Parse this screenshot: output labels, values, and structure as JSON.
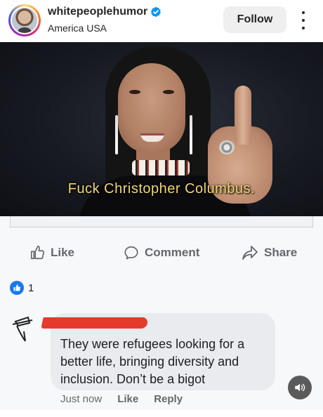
{
  "header": {
    "username": "whitepeoplehumor",
    "location": "America USA",
    "follow_label": "Follow",
    "verified_color": "#0095f6"
  },
  "post_image": {
    "caption": "Fuck Christopher Columbus."
  },
  "actions": {
    "like_label": "Like",
    "comment_label": "Comment",
    "share_label": "Share"
  },
  "reactions": {
    "count": "1",
    "badge_color": "#1877f2"
  },
  "comment": {
    "text": "They were refugees looking for a better life, bringing diversity and inclusion. Don’t be a bigot",
    "time": "Just now",
    "like_label": "Like",
    "reply_label": "Reply"
  },
  "icons": {
    "more": "more-vertical-icon",
    "verified": "verified-badge-icon",
    "like": "thumbs-up-icon",
    "comment": "speech-bubble-icon",
    "share": "share-arrow-icon",
    "sound": "speaker-icon"
  }
}
